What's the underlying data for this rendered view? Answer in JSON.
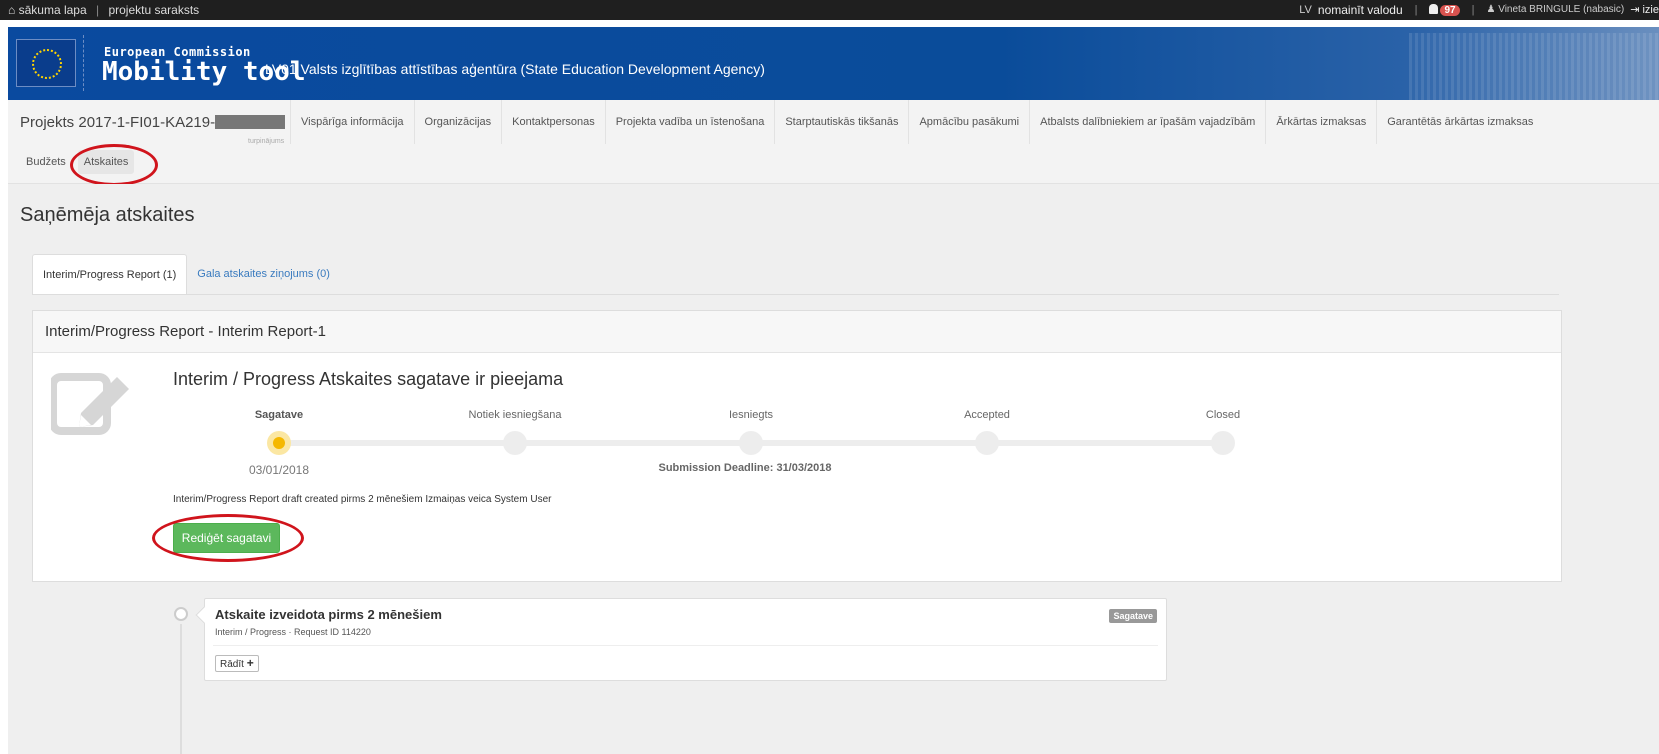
{
  "topbar": {
    "home": "sākuma lapa",
    "sep": "|",
    "projects": "projektu saraksts",
    "lang": "LV",
    "change_lang": "nomainīt valodu",
    "notifications": "97",
    "user": "Vineta BRINGULE (nabasic)",
    "exit": "izie"
  },
  "banner": {
    "ec": "European Commission",
    "tool": "Mobility tool",
    "agency": "LV01 Valsts izglītības attīstības aģentūra (State Education Development Agency)"
  },
  "project": {
    "title": "Projekts 2017-1-FI01-KA219-",
    "subtitle": "turpinājums",
    "tabs": [
      "Vispārīga informācija",
      "Organizācijas",
      "Kontaktpersonas",
      "Projekta vadība un īstenošana",
      "Starptautiskās tikšanās",
      "Apmācību pasākumi",
      "Atbalsts dalībniekiem ar īpašām vajadzībām",
      "Ārkārtas izmaksas",
      "Garantētās ārkārtas izmaksas"
    ],
    "tabs_row2": [
      "Budžets",
      "Atskaites"
    ]
  },
  "main": {
    "title": "Saņēmēja atskaites",
    "tabs": [
      "Interim/Progress Report (1)",
      "Gala atskaites ziņojums (0)"
    ],
    "panel": {
      "heading": "Interim/Progress Report - Interim Report-1",
      "title": "Interim / Progress Atskaites sagatave ir pieejama",
      "steps": [
        "Sagatave",
        "Notiek iesniegšana",
        "Iesniegts",
        "Accepted",
        "Closed"
      ],
      "date": "03/01/2018",
      "deadline": "Submission Deadline: 31/03/2018",
      "draft_info": "Interim/Progress Report draft created pirms 2 mēnešiem Izmaiņas veica System User",
      "edit_button": "Rediģēt sagatavi"
    },
    "timeline": {
      "title": "Atskaite izveidota pirms 2 mēnešiem",
      "subtitle": "Interim / Progress · Request ID 114220",
      "badge": "Sagatave",
      "show_button": "Rādīt"
    }
  },
  "colors": {
    "accent_green": "#5cb85c",
    "banner_blue": "#0a4a9f",
    "annotation_red": "#d0141c",
    "step_active": "#f5b800"
  }
}
